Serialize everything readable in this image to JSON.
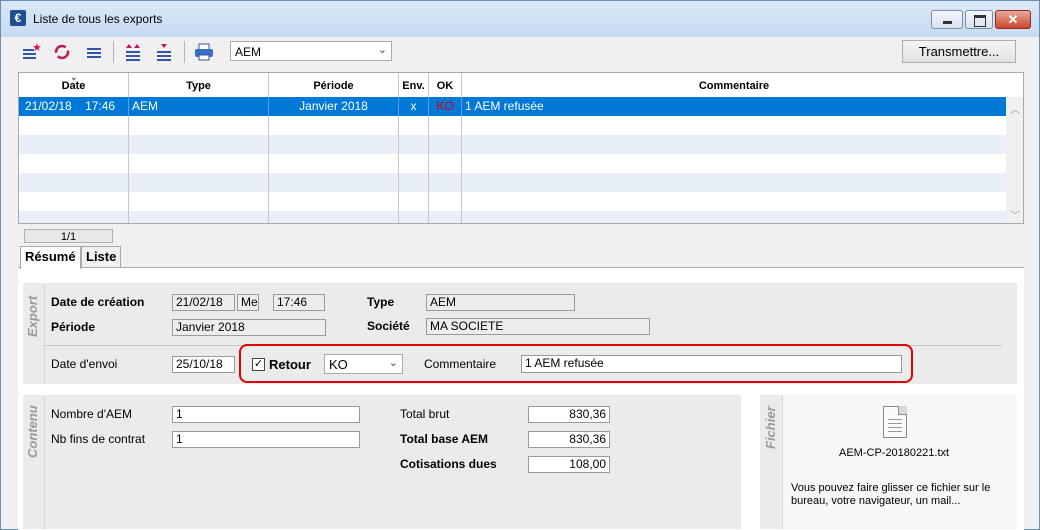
{
  "window": {
    "title": "Liste de tous les exports",
    "app_icon": "€"
  },
  "toolbar": {
    "export_type": "AEM",
    "transmit_label": "Transmettre..."
  },
  "grid": {
    "headers": [
      "Date",
      "Type",
      "Période",
      "Env.",
      "OK",
      "Commentaire"
    ],
    "rows": [
      {
        "date": "21/02/18",
        "time": "17:46",
        "type": "AEM",
        "periode": "Janvier 2018",
        "env": "x",
        "ok": "KO",
        "commentaire": "1 AEM refusée"
      }
    ],
    "selected_bg": "#0078d7",
    "ko_color": "#e00000"
  },
  "pager": "1/1",
  "tabs": [
    "Résumé",
    "Liste"
  ],
  "export": {
    "section_label": "Export",
    "date_creation_label": "Date de création",
    "date_creation": "21/02/18",
    "day": "Me",
    "time": "17:46",
    "type_label": "Type",
    "type": "AEM",
    "periode_label": "Période",
    "periode": "Janvier 2018",
    "societe_label": "Société",
    "societe": "MA SOCIETE",
    "date_envoi_label": "Date d'envoi",
    "date_envoi": "25/10/18",
    "retour_label": "Retour",
    "retour_value": "KO",
    "commentaire_label": "Commentaire",
    "commentaire": "1 AEM refusée"
  },
  "contenu": {
    "section_label": "Contenu",
    "nb_aem_label": "Nombre d'AEM",
    "nb_aem": "1",
    "nb_fins_label": "Nb fins de contrat",
    "nb_fins": "1",
    "total_brut_label": "Total brut",
    "total_brut": "830,36",
    "total_base_label": "Total base AEM",
    "total_base": "830,36",
    "cotisations_label": "Cotisations dues",
    "cotisations": "108,00"
  },
  "fichier": {
    "section_label": "Fichier",
    "filename": "AEM-CP-20180221.txt",
    "drop_hint": "Vous pouvez faire glisser ce fichier sur le bureau, votre navigateur, un mail..."
  }
}
